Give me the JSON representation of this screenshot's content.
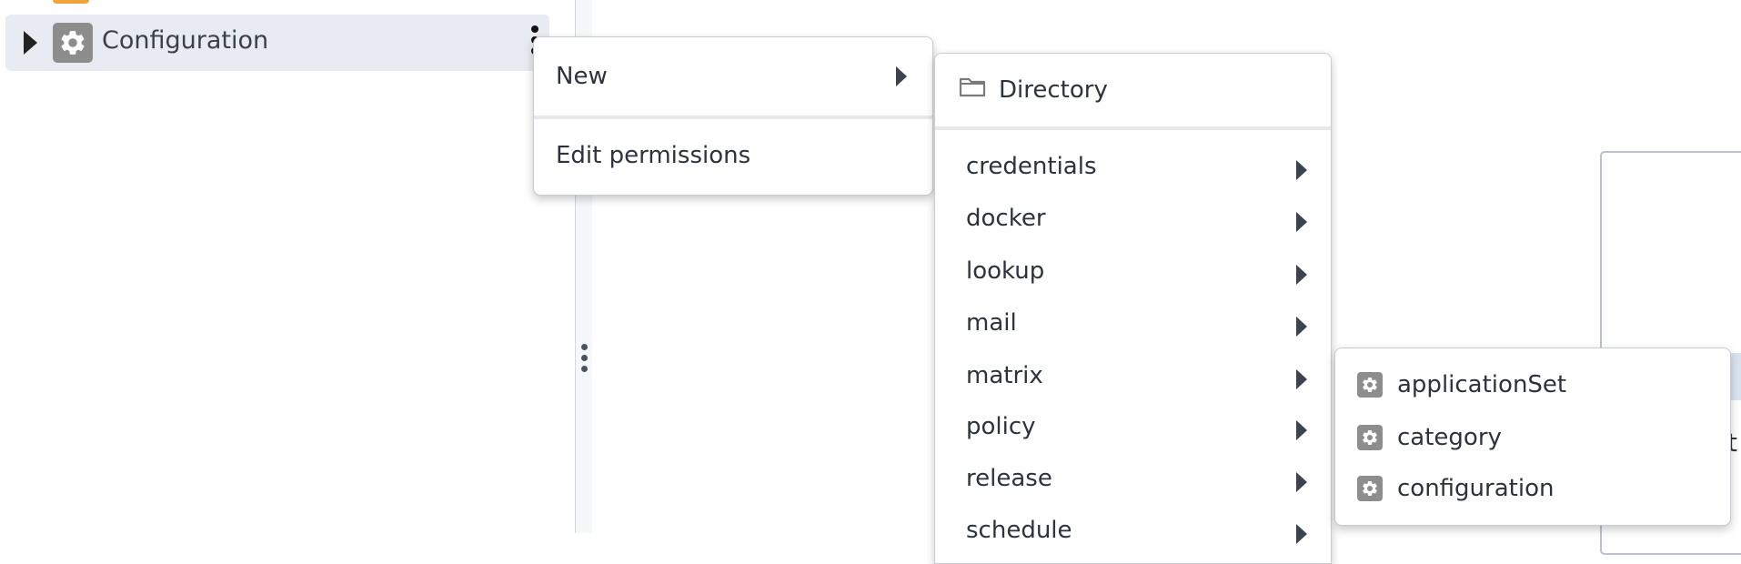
{
  "tree": {
    "item_label": "Configuration",
    "icon": "gear-icon",
    "toggle_icon": "caret-right-icon",
    "actions_icon": "kebab-menu-icon"
  },
  "context_menu": {
    "items": [
      {
        "label": "New",
        "has_submenu": true
      },
      {
        "label": "Edit permissions",
        "has_submenu": false
      }
    ]
  },
  "new_submenu": {
    "directory_label": "Directory",
    "directory_icon": "folder-icon",
    "items": [
      {
        "label": "credentials",
        "has_submenu": true
      },
      {
        "label": "docker",
        "has_submenu": true
      },
      {
        "label": "lookup",
        "has_submenu": true
      },
      {
        "label": "mail",
        "has_submenu": true
      },
      {
        "label": "matrix",
        "has_submenu": true
      },
      {
        "label": "policy",
        "has_submenu": true
      },
      {
        "label": "release",
        "has_submenu": true
      },
      {
        "label": "schedule",
        "has_submenu": true
      }
    ]
  },
  "matrix_submenu": {
    "items": [
      {
        "label": "applicationSet",
        "icon": "gear-icon"
      },
      {
        "label": "category",
        "icon": "gear-icon"
      },
      {
        "label": "configuration",
        "icon": "gear-icon"
      }
    ]
  },
  "background": {
    "partial_text": "t"
  },
  "colors": {
    "selected_row": "#e8ebf1",
    "icon_gray": "#8d8d8d",
    "accent_blue": "#3c89c4"
  }
}
